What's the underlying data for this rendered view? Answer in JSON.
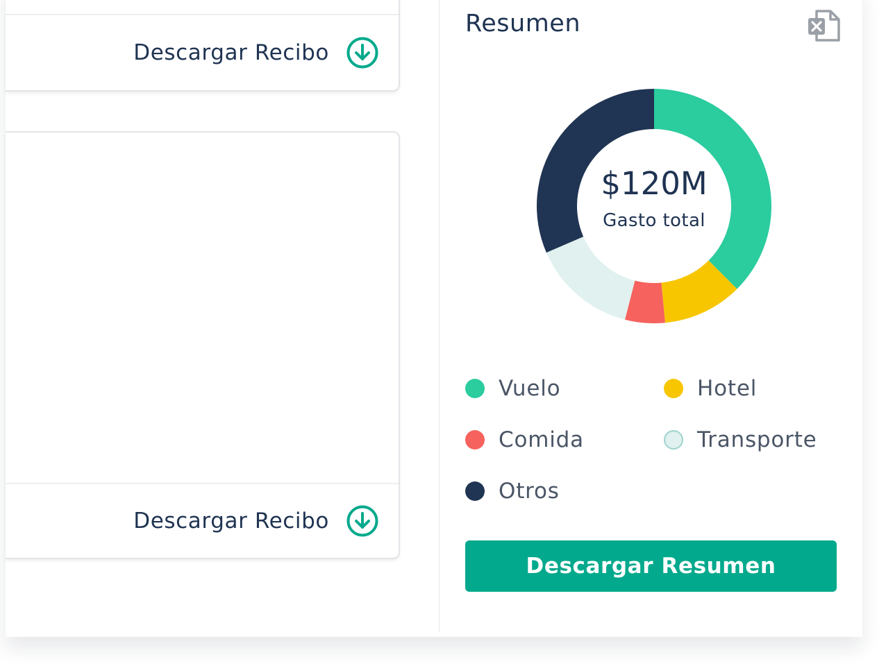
{
  "receipts": [
    {
      "download_label": "Descargar Recibo"
    },
    {
      "download_label": "Descargar Recibo"
    }
  ],
  "summary": {
    "title": "Resumen",
    "export_icon": "excel-file-icon",
    "total_amount": "$120M",
    "total_label": "Gasto total",
    "button_label": "Descargar Resumen"
  },
  "colors": {
    "accent": "#03a98c",
    "text": "#1f3352"
  },
  "chart_data": {
    "type": "pie",
    "center_value": "$120M",
    "center_label": "Gasto total",
    "series": [
      {
        "name": "Vuelo",
        "value": 37.5,
        "color": "#2bcc9e"
      },
      {
        "name": "Hotel",
        "value": 11,
        "color": "#f7c600"
      },
      {
        "name": "Comida",
        "value": 5.5,
        "color": "#f6625d"
      },
      {
        "name": "Transporte",
        "value": 14.5,
        "color": "#e0f1ef",
        "stroke": "#9fd3cd"
      },
      {
        "name": "Otros",
        "value": 31.5,
        "color": "#203453"
      }
    ],
    "legend": [
      "Vuelo",
      "Hotel",
      "Comida",
      "Transporte",
      "Otros"
    ]
  }
}
